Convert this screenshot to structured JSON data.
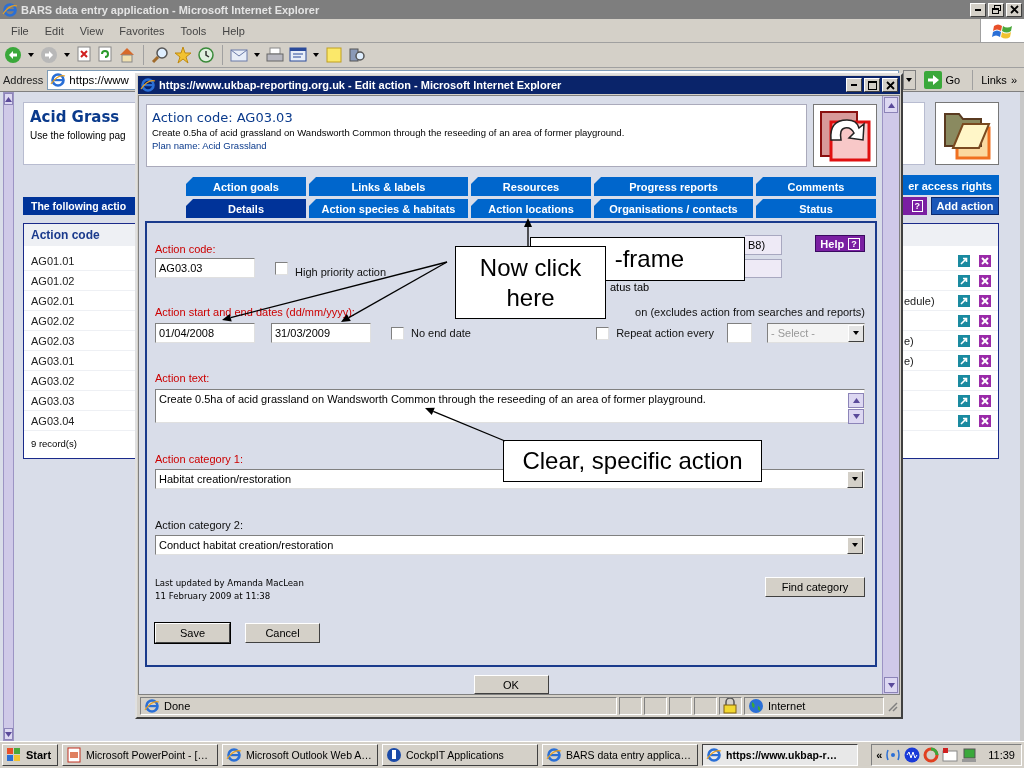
{
  "browser": {
    "title": "BARS data entry application - Microsoft Internet Explorer",
    "menu": [
      "File",
      "Edit",
      "View",
      "Favorites",
      "Tools",
      "Help"
    ],
    "address": {
      "label": "Address",
      "value": "https://www"
    },
    "go": "Go",
    "links": "Links",
    "links_more": "»"
  },
  "page": {
    "heading": "Acid Grass",
    "intro": "Use the following pag",
    "access_tab": "er access rights",
    "bar": "The following actio",
    "help_icon": "?",
    "add_action": "Add action",
    "list": {
      "column": "Action code",
      "rows": [
        {
          "code": "AG01.01"
        },
        {
          "code": "AG01.02"
        },
        {
          "code": "AG02.01",
          "tail": "edule)"
        },
        {
          "code": "AG02.02"
        },
        {
          "code": "AG02.03",
          "tail": "e)"
        },
        {
          "code": "AG03.01",
          "tail": "e)"
        },
        {
          "code": "AG03.02"
        },
        {
          "code": "AG03.03"
        },
        {
          "code": "AG03.04"
        }
      ],
      "footer": "9 record(s)"
    }
  },
  "popup": {
    "title": "https://www.ukbap-reporting.org.uk - Edit action - Microsoft Internet Explorer",
    "header": {
      "title": "Action code: AG03.03",
      "description": "Create 0.5ha of acid grassland on Wandsworth Common through the reseeding of an area of former playground.",
      "plan": "Plan name: Acid Grassland"
    },
    "tabs": [
      [
        {
          "label": "Action goals",
          "selected": false
        },
        {
          "label": "Links & labels",
          "selected": false
        },
        {
          "label": "Resources",
          "selected": false
        },
        {
          "label": "Progress reports",
          "selected": false
        },
        {
          "label": "Comments",
          "selected": false
        }
      ],
      [
        {
          "label": "Details",
          "selected": true
        },
        {
          "label": "Action species & habitats",
          "selected": false
        },
        {
          "label": "Action locations",
          "selected": false
        },
        {
          "label": "Organisations / contacts",
          "selected": false
        },
        {
          "label": "Status",
          "selected": false
        }
      ]
    ],
    "help": {
      "label": "Help",
      "icon": "?"
    },
    "form": {
      "code": {
        "label": "Action code:",
        "required": true,
        "value": "AG03.03"
      },
      "high_priority": {
        "label": "High priority action",
        "checked": false
      },
      "obscured_field": {
        "value": "B8)"
      },
      "status_note": "atus tab",
      "exclude_note": "on (excludes action from searches and reports)",
      "dates": {
        "label": "Action start and end dates (dd/mm/yyyy):",
        "required": true,
        "start": "01/04/2008",
        "end": "31/03/2009"
      },
      "no_end_date": {
        "label": "No end date",
        "checked": false
      },
      "repeat": {
        "label": "Repeat action every",
        "checked": false,
        "period": {
          "value": "- Select -",
          "disabled": true
        }
      },
      "text": {
        "label": "Action text:",
        "required": true,
        "value": "Create 0.5ha of acid grassland on Wandsworth Common through the reseeding of an area of former playground."
      },
      "category_1": {
        "label": "Action category 1:",
        "required": true,
        "value": "Habitat creation/restoration"
      },
      "category_2": {
        "label": "Action category 2:",
        "required": false,
        "value": "Conduct habitat creation/restoration"
      },
      "updated": [
        "Last updated by Amanda MacLean",
        "11 February 2009 at 11:38"
      ],
      "find_category": "Find category",
      "save": "Save",
      "cancel": "Cancel"
    },
    "ok": "OK",
    "status": {
      "text": "Done",
      "zone": "Internet"
    }
  },
  "callouts": [
    {
      "text": "-frame"
    },
    {
      "text": "Now click here"
    },
    {
      "text": "Clear, specific action"
    }
  ],
  "taskbar": {
    "start": "Start",
    "items": [
      {
        "label": "Microsoft PowerPoint - […",
        "selected": false
      },
      {
        "label": "Microsoft Outlook Web A…",
        "selected": false
      },
      {
        "label": "CockpIT Applications",
        "selected": false
      },
      {
        "label": "BARS data entry applica…",
        "selected": false
      },
      {
        "label": "https://www.ukbap-r…",
        "selected": true
      }
    ],
    "tray_more": "«",
    "clock": "11:39"
  }
}
